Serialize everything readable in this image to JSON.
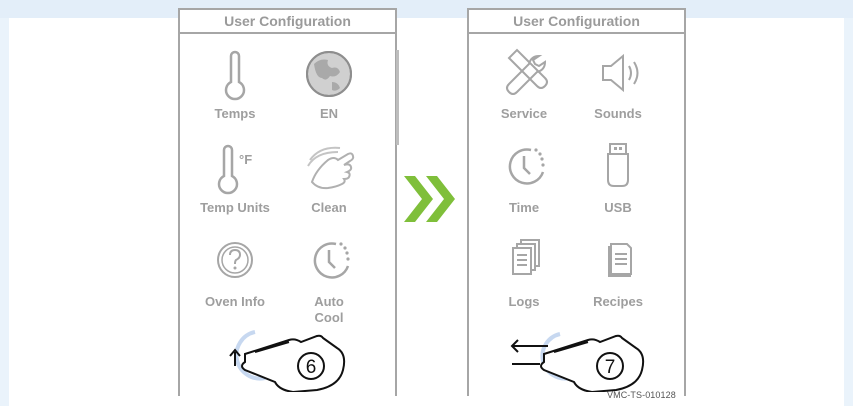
{
  "left_screen": {
    "title": "User Configuration",
    "tiles": [
      {
        "label": "Temps",
        "icon": "thermometer-icon"
      },
      {
        "label": "EN",
        "icon": "globe-icon"
      },
      {
        "label": "Temp Units",
        "icon": "thermometer-fahrenheit-icon",
        "glyph": "°F"
      },
      {
        "label": "Clean",
        "icon": "wiping-hand-icon"
      },
      {
        "label": "Oven Info",
        "icon": "question-circle-icon"
      },
      {
        "label": "Auto Cool",
        "icon": "clock-icon"
      }
    ]
  },
  "right_screen": {
    "title": "User Configuration",
    "tiles": [
      {
        "label": "Service",
        "icon": "wrench-screwdriver-icon"
      },
      {
        "label": "Sounds",
        "icon": "speaker-icon"
      },
      {
        "label": "Time",
        "icon": "clock-icon"
      },
      {
        "label": "USB",
        "icon": "usb-drive-icon"
      },
      {
        "label": "Logs",
        "icon": "stacked-documents-icon"
      },
      {
        "label": "Recipes",
        "icon": "recipe-document-icon"
      }
    ]
  },
  "steps": [
    "6",
    "7"
  ],
  "arrow_icon": "double-chevron-right-icon",
  "document_code": "VMC-TS-010128",
  "colors": {
    "accent_green": "#7fbf3a",
    "label_gray": "#9e9e9e",
    "border_gray": "#a6a6a6",
    "background": "#eaf3fb"
  }
}
